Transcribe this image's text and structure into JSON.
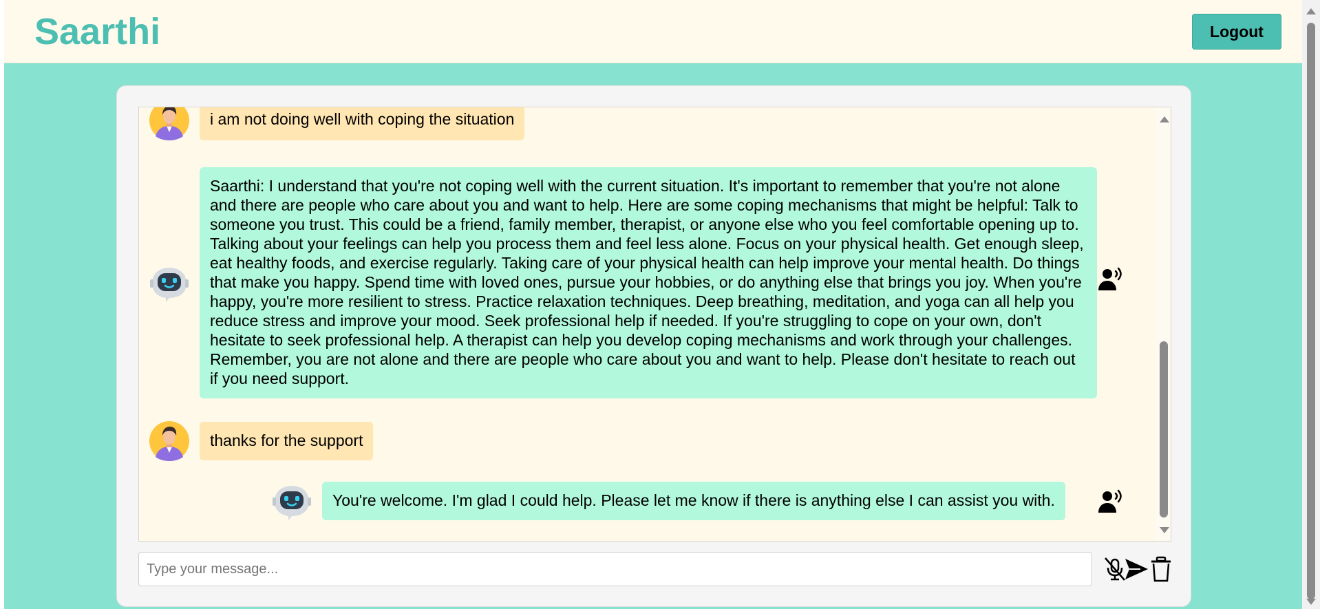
{
  "header": {
    "brand": "Saarthi",
    "logout_label": "Logout"
  },
  "chat": {
    "messages": [
      {
        "role": "user",
        "text": "i am not doing well with coping the situation"
      },
      {
        "role": "bot",
        "text": "Saarthi: I understand that you're not coping well with the current situation. It's important to remember that you're not alone and there are people who care about you and want to help. Here are some coping mechanisms that might be helpful: Talk to someone you trust. This could be a friend, family member, therapist, or anyone else who you feel comfortable opening up to. Talking about your feelings can help you process them and feel less alone. Focus on your physical health. Get enough sleep, eat healthy foods, and exercise regularly. Taking care of your physical health can help improve your mental health. Do things that make you happy. Spend time with loved ones, pursue your hobbies, or do anything else that brings you joy. When you're happy, you're more resilient to stress. Practice relaxation techniques. Deep breathing, meditation, and yoga can all help you reduce stress and improve your mood. Seek professional help if needed. If you're struggling to cope on your own, don't hesitate to seek professional help. A therapist can help you develop coping mechanisms and work through your challenges. Remember, you are not alone and there are people who care about you and want to help. Please don't hesitate to reach out if you need support."
      },
      {
        "role": "user",
        "text": "thanks for the support"
      },
      {
        "role": "bot",
        "text": "You're welcome. I'm glad I could help. Please let me know if there is anything else I can assist you with."
      }
    ]
  },
  "composer": {
    "placeholder": "Type your message..."
  },
  "icons": {
    "user_avatar": "user-avatar-icon",
    "bot_avatar": "robot-avatar-icon",
    "speaker": "text-to-speech-icon",
    "mic_off": "microphone-off-icon",
    "send": "send-icon",
    "delete": "trash-icon"
  },
  "colors": {
    "brand": "#4dbfb2",
    "background": "#87e2cf",
    "header_bg": "#fffaeb",
    "user_bubble": "#ffe6b2",
    "bot_bubble": "#b1f8dd"
  }
}
